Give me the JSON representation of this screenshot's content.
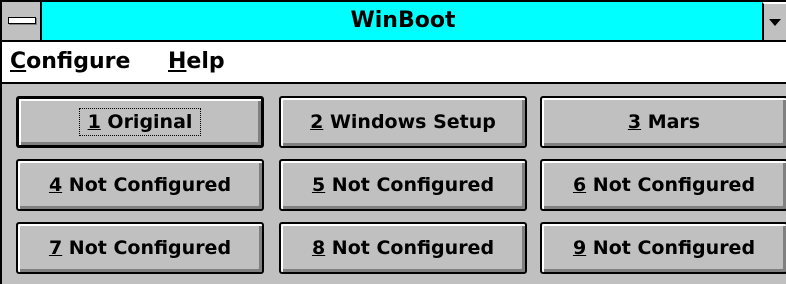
{
  "window": {
    "title": "WinBoot"
  },
  "menubar": {
    "items": [
      {
        "mnemonic": "C",
        "rest": "onfigure"
      },
      {
        "mnemonic": "H",
        "rest": "elp"
      }
    ]
  },
  "buttons": [
    {
      "mnemonic": "1",
      "rest": " Original"
    },
    {
      "mnemonic": "2",
      "rest": " Windows Setup"
    },
    {
      "mnemonic": "3",
      "rest": " Mars"
    },
    {
      "mnemonic": "4",
      "rest": " Not Configured"
    },
    {
      "mnemonic": "5",
      "rest": " Not Configured"
    },
    {
      "mnemonic": "6",
      "rest": " Not Configured"
    },
    {
      "mnemonic": "7",
      "rest": " Not Configured"
    },
    {
      "mnemonic": "8",
      "rest": " Not Configured"
    },
    {
      "mnemonic": "9",
      "rest": " Not Configured"
    }
  ],
  "colors": {
    "titlebar": "#00ffff",
    "face": "#c0c0c0",
    "menubar": "#ffffff"
  },
  "icons": {
    "system_menu": "system-menu-icon",
    "minimize": "minimize-arrow-icon"
  }
}
